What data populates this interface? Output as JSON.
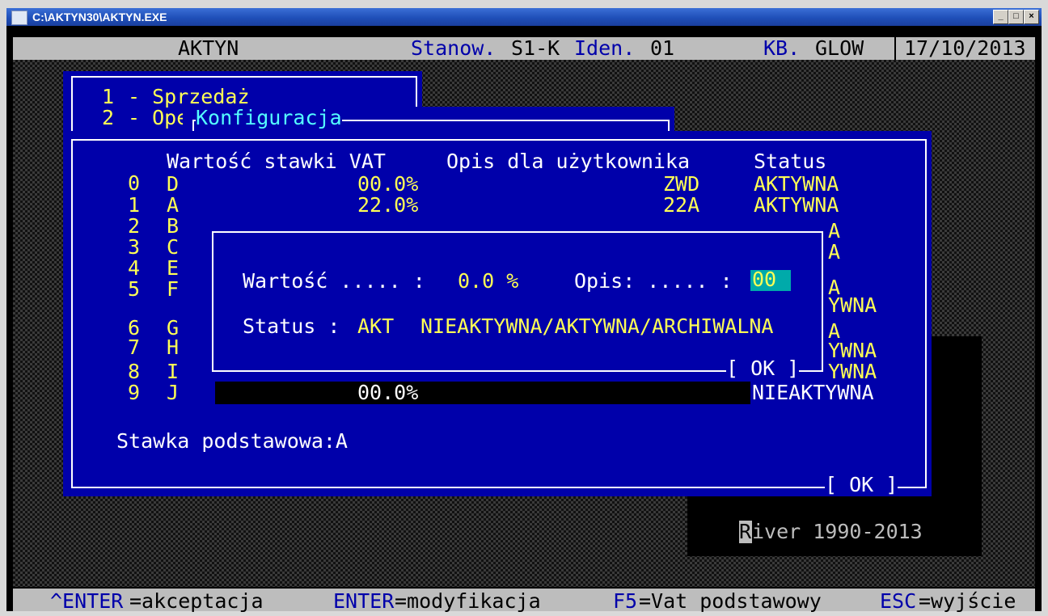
{
  "window": {
    "title": "C:\\AKTYN30\\AKTYN.EXE",
    "buttons": {
      "minimize": "_",
      "maximize": "□",
      "close": "×"
    }
  },
  "status": {
    "app": "AKTYN",
    "stanow_label": "Stanow.",
    "stanow_value": "S1-K",
    "iden_label": "Iden.",
    "iden_value": "01",
    "kb_label": "KB.",
    "kb_value": "GLOW",
    "date": "17/10/2013"
  },
  "menu": {
    "items": [
      {
        "num": "1",
        "label": "- Sprzedaż"
      },
      {
        "num": "2",
        "label": "- Ope"
      }
    ]
  },
  "config": {
    "title": "Konfiguracja",
    "headers": {
      "value": "Wartość stawki VAT",
      "desc": "Opis dla użytkownika",
      "status": "Status"
    },
    "rows": [
      {
        "num": "0",
        "letter": "D",
        "value": "00.0%",
        "desc": "ZWD",
        "status": "AKTYWNA"
      },
      {
        "num": "1",
        "letter": "A",
        "value": "22.0%",
        "desc": "22A",
        "status": "AKTYWNA"
      },
      {
        "num": "2",
        "letter": "B",
        "value": "",
        "desc": "",
        "status": "A"
      },
      {
        "num": "3",
        "letter": "C",
        "value": "",
        "desc": "",
        "status": "A"
      },
      {
        "num": "4",
        "letter": "E",
        "value": "",
        "desc": "",
        "status": "A"
      },
      {
        "num": "5",
        "letter": "F",
        "value": "",
        "desc": "",
        "status": "YWNA"
      },
      {
        "num": "6",
        "letter": "G",
        "value": "",
        "desc": "",
        "status": "A"
      },
      {
        "num": "7",
        "letter": "H",
        "value": "",
        "desc": "",
        "status": "YWNA"
      },
      {
        "num": "8",
        "letter": "I",
        "value": "",
        "desc": "",
        "status": "YWNA"
      },
      {
        "num": "9",
        "letter": "J",
        "value": "00.0%",
        "desc": "",
        "status": "NIEAKTYWNA"
      }
    ],
    "base_rate": "Stawka podstawowa:A",
    "ok": "[ OK ]"
  },
  "dialog": {
    "value_label": "Wartość ..... :",
    "value": "0.0 %",
    "desc_label": "Opis: ..... :",
    "desc_value": "00",
    "status_label": "Status :",
    "status_value": "AKT",
    "status_options": "NIEAKTYWNA/AKTYWNA/ARCHIWALNA",
    "ok": "[ OK ]"
  },
  "info": {
    "river_first": "R",
    "river_rest": "iver 1990-2013"
  },
  "help": {
    "items": [
      {
        "key": "^ENTER",
        "text": "=akceptacja"
      },
      {
        "key": "ENTER",
        "text": "=modyfikacja"
      },
      {
        "key": "F5",
        "text": "=Vat podstawowy"
      },
      {
        "key": "ESC",
        "text": "=wyjście"
      }
    ]
  },
  "colors": {
    "dos_blue": "#0000aa",
    "dos_yellow": "#ffff55",
    "dos_cyan": "#55ffff",
    "titlebar": "#2358c4"
  }
}
